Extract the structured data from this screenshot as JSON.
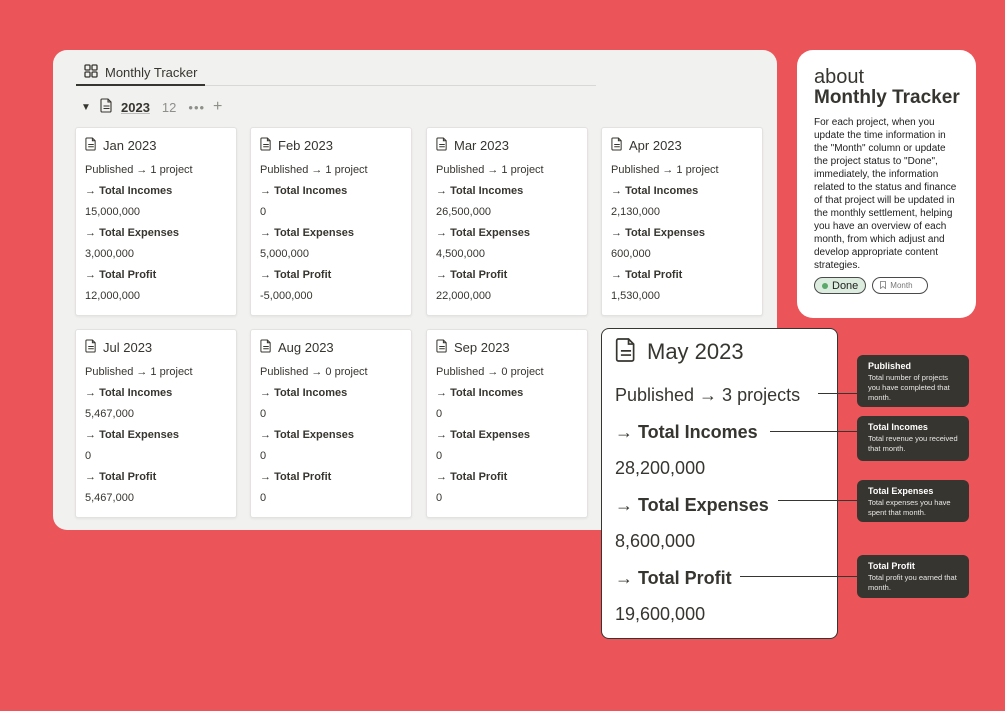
{
  "tab": {
    "label": "Monthly Tracker",
    "icon": "gallery-icon"
  },
  "group": {
    "title": "2023",
    "count": "12",
    "more": "•••",
    "add": "+",
    "caret": "▼"
  },
  "cards": [
    {
      "title": "Jan 2023",
      "published": "Published → 1 project",
      "incomes_label": "Total Incomes",
      "incomes": "15,000,000",
      "expenses_label": "Total Expenses",
      "expenses": "3,000,000",
      "profit_label": "Total Profit",
      "profit": "12,000,000"
    },
    {
      "title": "Feb 2023",
      "published": "Published → 1 project",
      "incomes_label": "Total Incomes",
      "incomes": "0",
      "expenses_label": "Total Expenses",
      "expenses": "5,000,000",
      "profit_label": "Total Profit",
      "profit": "-5,000,000"
    },
    {
      "title": "Mar 2023",
      "published": "Published → 1 project",
      "incomes_label": "Total Incomes",
      "incomes": "26,500,000",
      "expenses_label": "Total Expenses",
      "expenses": "4,500,000",
      "profit_label": "Total Profit",
      "profit": "22,000,000"
    },
    {
      "title": "Apr 2023",
      "published": "Published → 1 project",
      "incomes_label": "Total Incomes",
      "incomes": "2,130,000",
      "expenses_label": "Total Expenses",
      "expenses": "600,000",
      "profit_label": "Total Profit",
      "profit": "1,530,000"
    },
    {
      "title": "Jul 2023",
      "published": "Published → 1 project",
      "incomes_label": "Total Incomes",
      "incomes": "5,467,000",
      "expenses_label": "Total Expenses",
      "expenses": "0",
      "profit_label": "Total Profit",
      "profit": "5,467,000"
    },
    {
      "title": "Aug 2023",
      "published": "Published → 0 project",
      "incomes_label": "Total Incomes",
      "incomes": "0",
      "expenses_label": "Total Expenses",
      "expenses": "0",
      "profit_label": "Total Profit",
      "profit": "0"
    },
    {
      "title": "Sep 2023",
      "published": "Published → 0 project",
      "incomes_label": "Total Incomes",
      "incomes": "0",
      "expenses_label": "Total Expenses",
      "expenses": "0",
      "profit_label": "Total Profit",
      "profit": "0"
    }
  ],
  "about": {
    "small": "about",
    "big": "Monthly Tracker",
    "text": "For each project, when you update the time information in the \"Month\" column or update the project status to \"Done\", immediately, the information related to the status and finance of that project will be updated in the monthly settlement, helping you have an overview of each month, from which adjust and develop appropriate content strategies.",
    "tag_done": "Done",
    "tag_month": "Month"
  },
  "zoom": {
    "title": "May 2023",
    "published": "Published → 3 projects",
    "incomes_label": "→ Total Incomes",
    "incomes": "28,200,000",
    "expenses_label": "→ Total Expenses",
    "expenses": "8,600,000",
    "profit_label": "→ Total Profit",
    "profit": "19,600,000"
  },
  "notes": [
    {
      "title": "Published",
      "text": "Total number of projects you have completed that month."
    },
    {
      "title": "Total Incomes",
      "text": "Total revenue you received that month."
    },
    {
      "title": "Total Expenses",
      "text": "Total expenses you have spent that month."
    },
    {
      "title": "Total Profit",
      "text": "Total profit you earned that month."
    }
  ],
  "colors": {
    "background": "#eb555a",
    "panel": "#f1f1ef",
    "note": "#37352f",
    "done_tag": "#dcecdf"
  }
}
